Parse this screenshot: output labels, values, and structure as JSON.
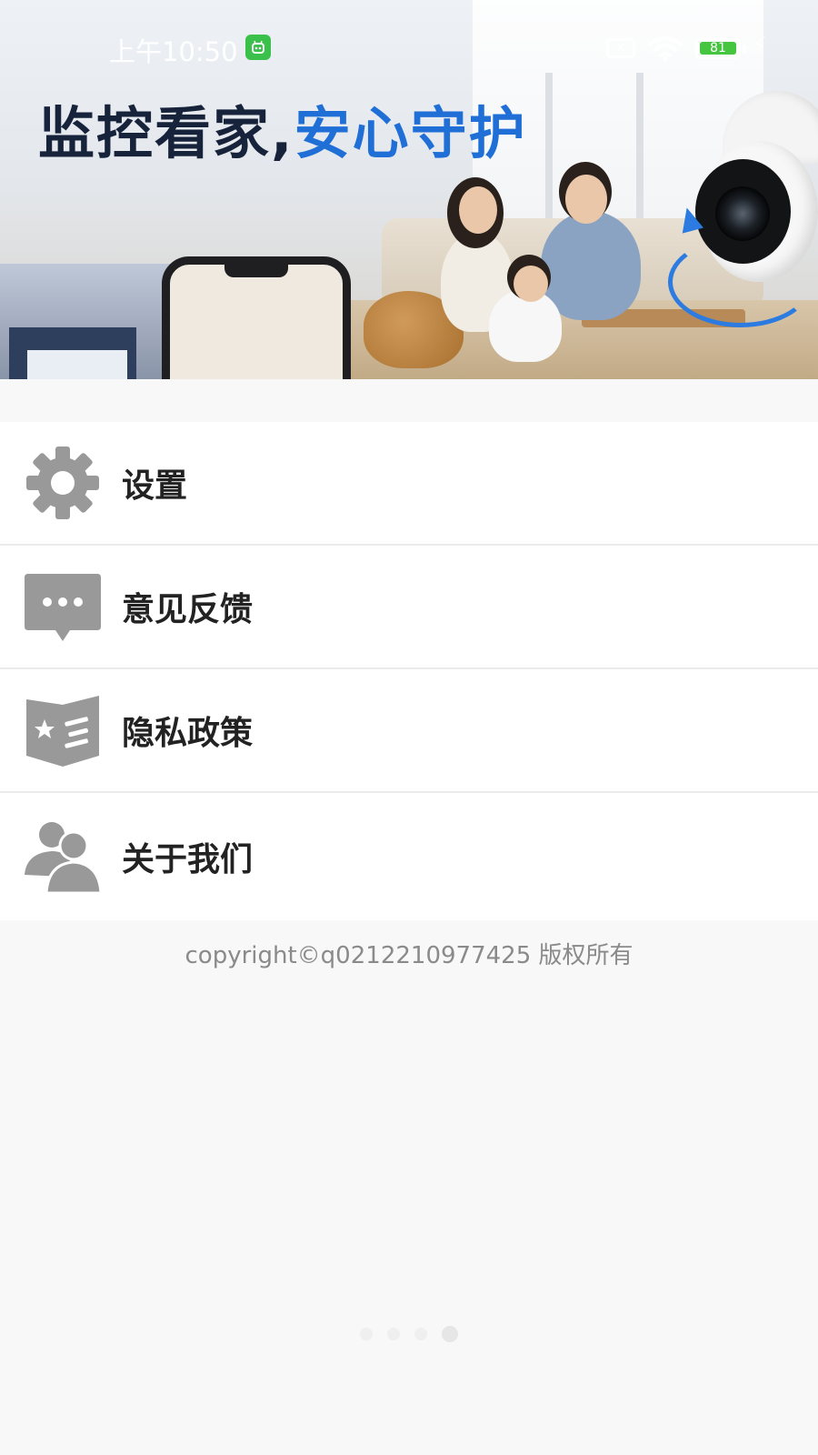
{
  "status_bar": {
    "time": "上午10:50",
    "battery_level": "81",
    "battery_color": "#46c541",
    "icons": [
      "app-badge-icon",
      "sim-off-icon",
      "wifi-icon",
      "battery-icon",
      "charging-bolt-icon"
    ]
  },
  "banner": {
    "headline_dark": "监控看家,",
    "headline_blue": "安心守护",
    "accent_color": "#1f6fd6",
    "dark_color": "#17233a"
  },
  "menu": {
    "items": [
      {
        "label": "设置",
        "icon": "gear-icon"
      },
      {
        "label": "意见反馈",
        "icon": "chat-bubble-icon"
      },
      {
        "label": "隐私政策",
        "icon": "policy-book-icon"
      },
      {
        "label": "关于我们",
        "icon": "users-icon"
      }
    ],
    "icon_color": "#999999"
  },
  "footer": {
    "copyright": "copyright©q0212210977425 版权所有"
  },
  "pager": {
    "count": 4,
    "active_index": 3
  }
}
